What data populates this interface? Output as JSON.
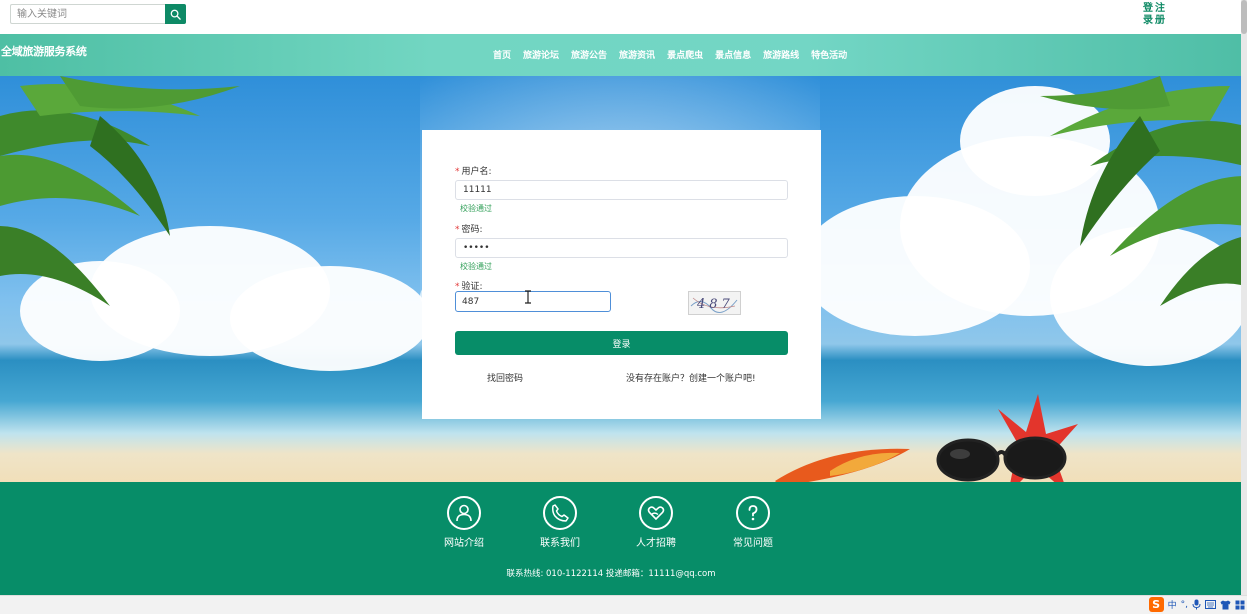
{
  "header": {
    "search_placeholder": "输入关键词",
    "auth": {
      "login_chars": [
        "登",
        "录"
      ],
      "register_chars": [
        "注",
        "册"
      ]
    }
  },
  "nav": {
    "site_title": "全域旅游服务系统",
    "items": [
      "首页",
      "旅游论坛",
      "旅游公告",
      "旅游资讯",
      "景点爬虫",
      "景点信息",
      "旅游路线",
      "特色活动"
    ]
  },
  "login": {
    "username_label": "用户名:",
    "username_value": "11111",
    "username_valid": "校验通过",
    "password_label": "密码:",
    "password_value": "11111",
    "password_valid": "校验通过",
    "captcha_label": "验证:",
    "captcha_value": "487",
    "captcha_image_text": "487",
    "submit_label": "登录",
    "forgot_link": "找回密码",
    "register_link": "没有存在账户？创建一个账户吧!"
  },
  "footer": {
    "items": [
      {
        "label": "网站介绍",
        "icon": "user-icon"
      },
      {
        "label": "联系我们",
        "icon": "phone-icon"
      },
      {
        "label": "人才招聘",
        "icon": "heart-hand-icon"
      },
      {
        "label": "常见问题",
        "icon": "question-icon"
      }
    ],
    "contact": "联系热线: 010-1122114 投递邮箱：11111@qq.com"
  },
  "tray": {
    "ime_lang": "中",
    "ime_punct": "°,"
  },
  "colors": {
    "primary": "#078d68",
    "nav_gradient": "#72d6c2",
    "valid": "#33a05a",
    "required": "#e23a3a"
  }
}
